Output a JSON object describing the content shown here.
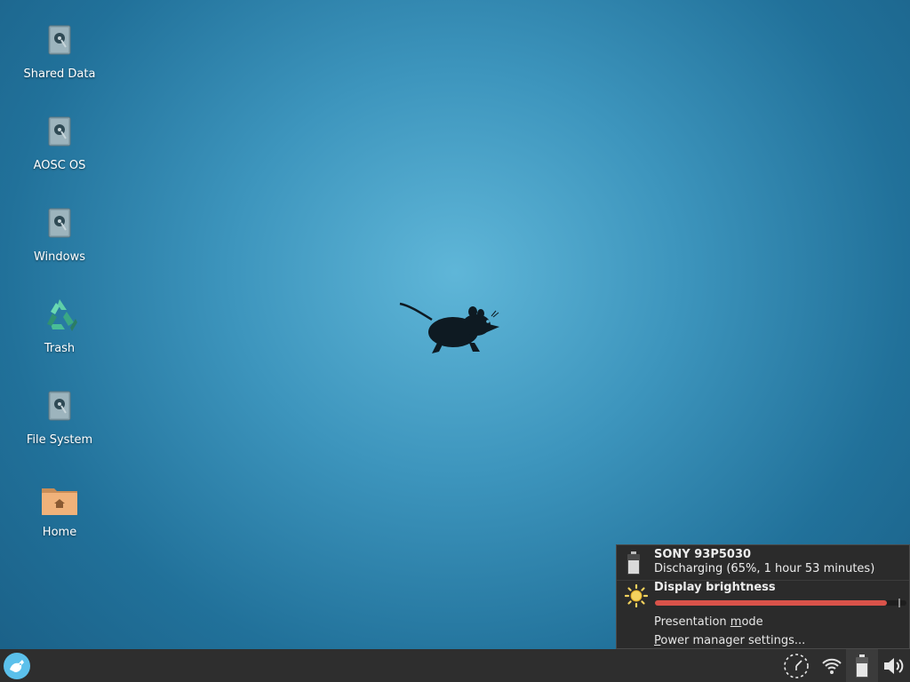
{
  "desktop": {
    "icons": [
      {
        "label": "Shared Data",
        "icon": "drive-icon"
      },
      {
        "label": "AOSC OS",
        "icon": "drive-icon"
      },
      {
        "label": "Windows",
        "icon": "drive-icon"
      },
      {
        "label": "Trash",
        "icon": "recycle-icon"
      },
      {
        "label": "File System",
        "icon": "drive-icon"
      },
      {
        "label": "Home",
        "icon": "home-folder-icon"
      }
    ],
    "wallpaper_logo": "xfce-mouse-logo"
  },
  "power_popup": {
    "battery": {
      "device_name": "SONY 93P5030",
      "status": "Discharging (65%, 1 hour 53 minutes)",
      "charge_percent": 65
    },
    "brightness": {
      "title": "Display brightness",
      "level_fraction": 0.98
    },
    "menu": {
      "presentation_prefix": "Presentation ",
      "presentation_mnemonic": "m",
      "presentation_suffix": "ode",
      "settings_mnemonic": "P",
      "settings_suffix": "ower manager settings..."
    }
  },
  "panel": {
    "menu_button_icon": "xfce-menu-icon",
    "tray": [
      "clock-icon",
      "wifi-icon",
      "battery-icon",
      "volume-icon"
    ]
  },
  "colors": {
    "accent_slider": "#d9534a",
    "panel_bg": "#2e2e2e",
    "popup_bg": "#2b2b2b",
    "folder": "#e8a86c"
  }
}
